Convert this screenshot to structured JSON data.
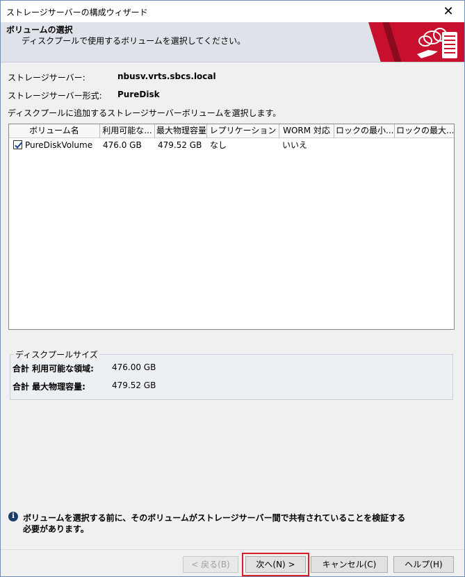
{
  "window": {
    "title": "ストレージサーバーの構成ウィザード",
    "close_glyph": "✕"
  },
  "header": {
    "title": "ボリュームの選択",
    "subtitle": "ディスクプールで使用するボリュームを選択してください。",
    "banner_icon": "cloud-server-icon",
    "banner_color": "#c8102e"
  },
  "server": {
    "name_label": "ストレージサーバー:",
    "name_value": "nbusv.vrts.sbcs.local",
    "type_label": "ストレージサーバー形式:",
    "type_value": "PureDisk"
  },
  "instruction": "ディスクプールに追加するストレージサーバーボリュームを選択します。",
  "table": {
    "headers": [
      "ボリューム名",
      "利用可能な...",
      "最大物理容量",
      "レプリケーション",
      "WORM 対応",
      "ロックの最小...",
      "ロックの最大..."
    ],
    "rows": [
      {
        "checked": true,
        "volume": "PureDiskVolume",
        "available": "476.0 GB",
        "max_physical": "479.52 GB",
        "replication": "なし",
        "worm": "いいえ",
        "lock_min": "",
        "lock_max": ""
      }
    ]
  },
  "pool": {
    "legend": "ディスクプールサイズ",
    "available_label": "合計 利用可能な領域:",
    "available_value": "476.00 GB",
    "max_label": "合計 最大物理容量:",
    "max_value": "479.52 GB"
  },
  "info": {
    "line1": "ボリュームを選択する前に、そのボリュームがストレージサーバー間で共有されていることを検証する",
    "line2": "必要があります。"
  },
  "buttons": {
    "back": "< 戻る(B)",
    "next": "次へ(N) >",
    "cancel": "キャンセル(C)",
    "help": "ヘルプ(H)"
  }
}
